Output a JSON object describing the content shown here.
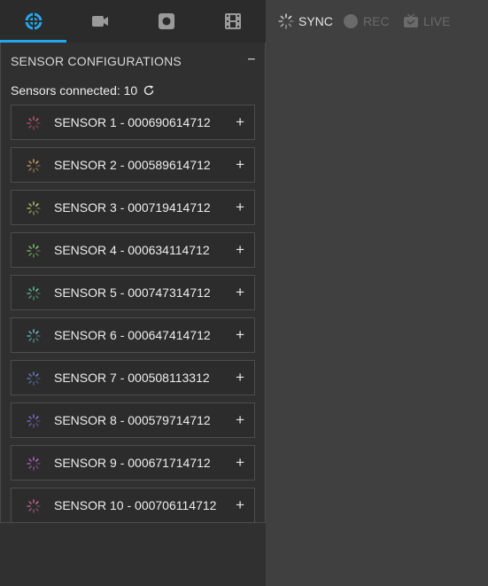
{
  "tabs": [
    {
      "name": "sensor-tab",
      "icon": "sensor-icon",
      "active": true
    },
    {
      "name": "video-tab",
      "icon": "video-camera-icon",
      "active": false
    },
    {
      "name": "record-tab",
      "icon": "record-icon",
      "active": false
    },
    {
      "name": "film-tab",
      "icon": "film-icon",
      "active": false
    }
  ],
  "status": {
    "sync_label": "SYNC",
    "rec_label": "REC",
    "live_label": "LIVE"
  },
  "config": {
    "title": "SENSOR CONFIGURATIONS",
    "collapse": "−",
    "connected_label": "Sensors connected: 10",
    "add": "+"
  },
  "sensors": [
    {
      "label": "SENSOR 1 - 000690614712",
      "color": "#e0607a"
    },
    {
      "label": "SENSOR 2 - 000589614712",
      "color": "#e8b070"
    },
    {
      "label": "SENSOR 3 - 000719414712",
      "color": "#d8e070"
    },
    {
      "label": "SENSOR 4 - 000634114712",
      "color": "#90e070"
    },
    {
      "label": "SENSOR 5 - 000747314712",
      "color": "#70e0a8"
    },
    {
      "label": "SENSOR 6 - 000647414712",
      "color": "#70d8e0"
    },
    {
      "label": "SENSOR 7 - 000508113312",
      "color": "#7090e8"
    },
    {
      "label": "SENSOR 8 - 000579714712",
      "color": "#9878e8"
    },
    {
      "label": "SENSOR 9 - 000671714712",
      "color": "#d070e0"
    },
    {
      "label": "SENSOR 10 - 000706114712",
      "color": "#e070a8"
    }
  ],
  "colors": {
    "accent": "#22a8ee",
    "icon_inactive": "#9a9a9a",
    "status_inactive": "#6a6a6a"
  }
}
